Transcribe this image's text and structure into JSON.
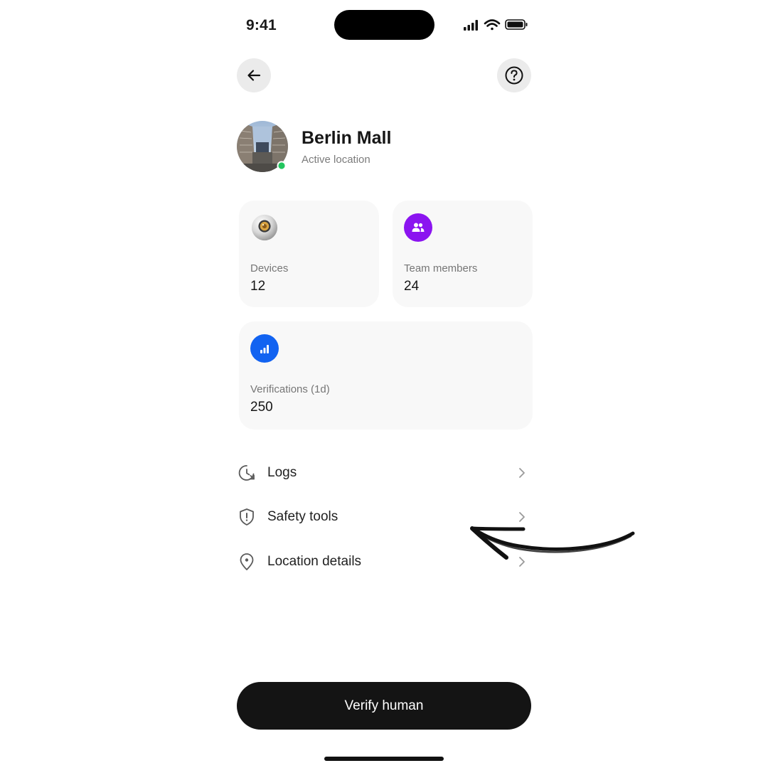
{
  "status_bar": {
    "time": "9:41"
  },
  "header": {
    "back_icon": "arrow-left-icon",
    "help_icon": "help-circle-icon"
  },
  "location": {
    "name": "Berlin Mall",
    "status": "Active location",
    "status_color": "#22c55e"
  },
  "stats": {
    "devices": {
      "label": "Devices",
      "value": "12",
      "icon": "orb-device-icon"
    },
    "team_members": {
      "label": "Team members",
      "value": "24",
      "icon": "people-icon",
      "icon_color": "#8b14f0"
    },
    "verifications": {
      "label": "Verifications (1d)",
      "value": "250",
      "icon": "bar-chart-icon",
      "icon_color": "#1263f1"
    }
  },
  "menu": {
    "items": [
      {
        "label": "Logs",
        "icon": "clock-history-icon"
      },
      {
        "label": "Safety tools",
        "icon": "shield-alert-icon"
      },
      {
        "label": "Location details",
        "icon": "map-pin-icon"
      }
    ]
  },
  "cta": {
    "label": "Verify human"
  },
  "colors": {
    "card_background": "#f8f8f8",
    "cta_background": "#141414"
  }
}
